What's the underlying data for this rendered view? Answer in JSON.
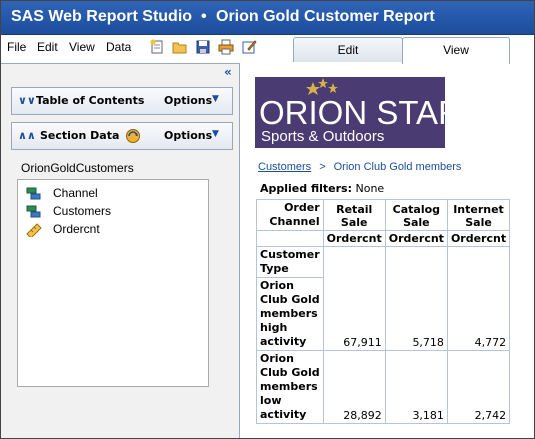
{
  "title": {
    "app": "SAS Web Report Studio",
    "separator": "•",
    "report": "Orion Gold Customer Report"
  },
  "menu": [
    {
      "label": "File"
    },
    {
      "label": "Edit"
    },
    {
      "label": "View"
    },
    {
      "label": "Data"
    }
  ],
  "toolbar_icons": [
    "new-report-icon",
    "open-folder-icon",
    "save-icon",
    "print-icon",
    "edit-properties-icon"
  ],
  "tabs": {
    "edit": "Edit",
    "view": "View",
    "active": "View"
  },
  "left_panel": {
    "collapse_glyph": "«",
    "toc": {
      "title": "Table of Contents",
      "options": "Options"
    },
    "section_data": {
      "title": "Section Data",
      "options": "Options"
    },
    "data_source": "OrionGoldCustomers",
    "items": [
      {
        "label": "Channel",
        "icon": "category-icon"
      },
      {
        "label": "Customers",
        "icon": "category-icon"
      },
      {
        "label": "Ordercnt",
        "icon": "measure-icon"
      }
    ]
  },
  "report": {
    "logo": {
      "line1": "ORION STAR",
      "line2": "Sports & Outdoors"
    },
    "breadcrumb": {
      "link": "Customers",
      "separator": ">",
      "current": "Orion Club Gold members"
    },
    "filters": {
      "label": "Applied filters:",
      "value": "None"
    },
    "table": {
      "corner": "Order Channel",
      "columns": [
        "Retail Sale",
        "Catalog Sale",
        "Internet Sale"
      ],
      "measure": "Ordercnt",
      "row_header": "Customer Type",
      "rows": [
        {
          "label": "Orion Club Gold members high activity",
          "values": [
            "67,911",
            "5,718",
            "4,772"
          ]
        },
        {
          "label": "Orion Club Gold members low activity",
          "values": [
            "28,892",
            "3,181",
            "2,742"
          ]
        }
      ]
    }
  },
  "colors": {
    "title_bar": "#1d4d9c",
    "link": "#1d4d9c",
    "logo_bg": "#4b3b73"
  }
}
